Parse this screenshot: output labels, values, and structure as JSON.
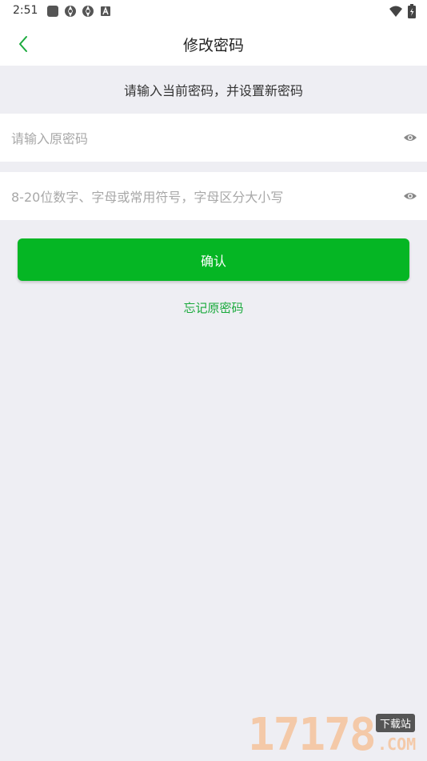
{
  "status_bar": {
    "time": "2:51",
    "icons": [
      "app-square-icon",
      "aperture-icon",
      "aperture-icon",
      "a-badge-icon"
    ],
    "right_icons": [
      "wifi-icon",
      "battery-icon"
    ]
  },
  "nav": {
    "title": "修改密码",
    "back_icon": "chevron-left-icon",
    "back_color": "#1aaa3c"
  },
  "hint": "请输入当前密码，并设置新密码",
  "old_password": {
    "placeholder": "请输入原密码",
    "value": "",
    "toggle_icon": "eye-icon"
  },
  "new_password": {
    "placeholder": "8-20位数字、字母或常用符号，字母区分大小写",
    "value": "",
    "toggle_icon": "eye-icon"
  },
  "confirm_label": "确认",
  "forgot_label": "忘记原密码",
  "colors": {
    "accent": "#05b624",
    "link": "#1aaa3c",
    "background": "#eeeef3"
  },
  "watermark": {
    "number": "17178",
    "badge": "下载站",
    "suffix": ".COM"
  }
}
